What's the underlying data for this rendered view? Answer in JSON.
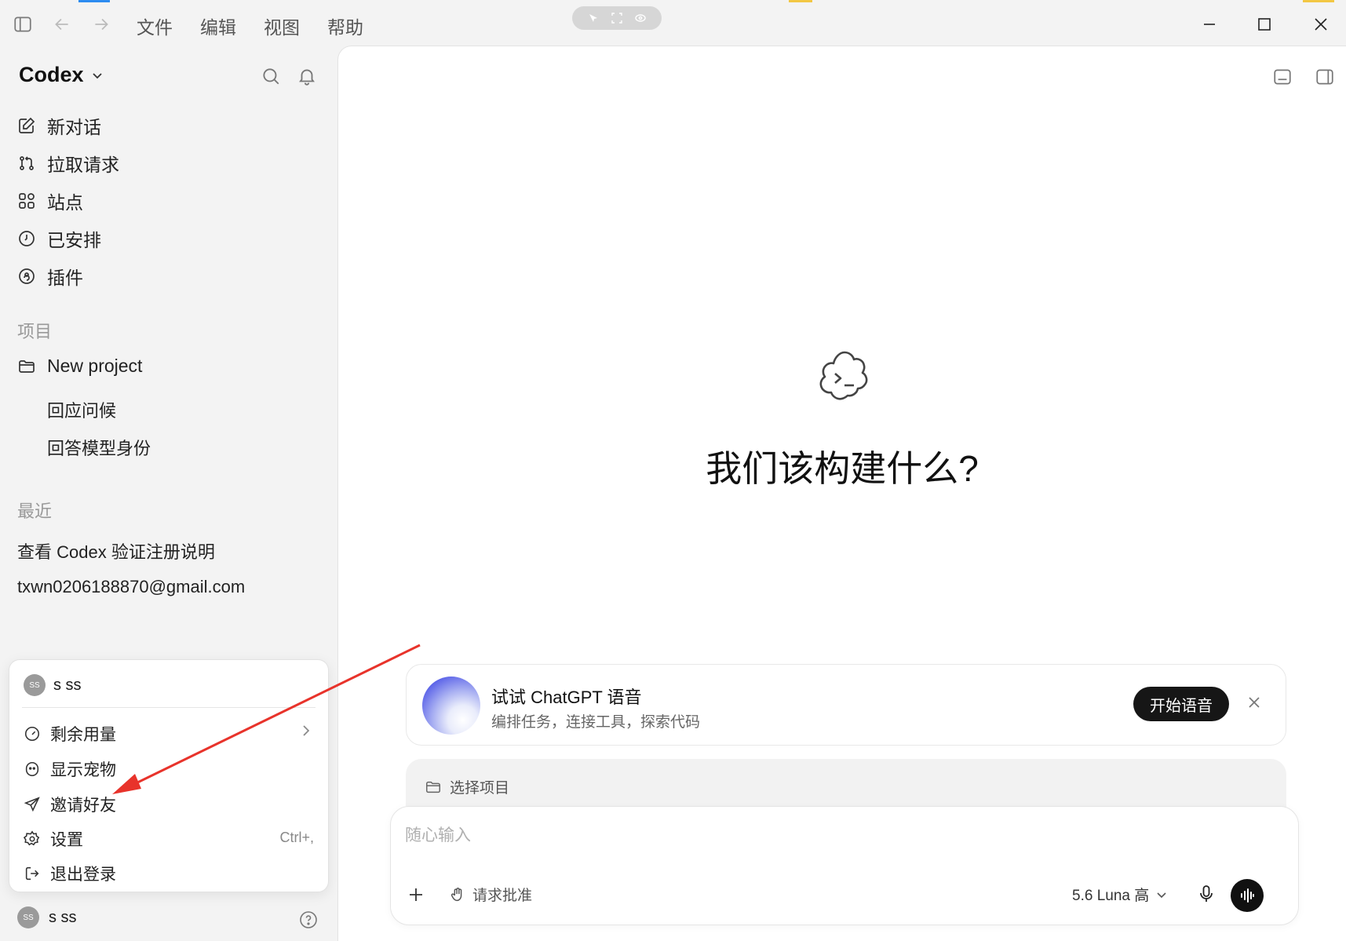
{
  "menubar": {
    "file": "文件",
    "edit": "编辑",
    "view": "视图",
    "help": "帮助"
  },
  "colors": {
    "annotation_arrow": "#e8332b",
    "accent_blue": "#2d8cf0",
    "accent_yellow": "#f2c744"
  },
  "sidebar": {
    "brand": "Codex",
    "nav": [
      {
        "label": "新对话",
        "icon": "edit-icon"
      },
      {
        "label": "拉取请求",
        "icon": "pull-request-icon"
      },
      {
        "label": "站点",
        "icon": "grid-icon"
      },
      {
        "label": "已安排",
        "icon": "clock-icon"
      },
      {
        "label": "插件",
        "icon": "plugin-icon"
      }
    ],
    "projects_label": "项目",
    "project_name": "New project",
    "project_threads": [
      "回应问候",
      "回答模型身份"
    ],
    "recent_label": "最近",
    "recent": [
      "查看 Codex 验证注册说明",
      "txwn0206188870@gmail.com"
    ]
  },
  "popup": {
    "avatar_text": "SS",
    "user_name": "s ss",
    "items": [
      {
        "label": "剩余用量",
        "icon": "gauge-icon"
      },
      {
        "label": "显示宠物",
        "icon": "pet-icon"
      },
      {
        "label": "邀请好友",
        "icon": "send-icon"
      },
      {
        "label": "设置",
        "icon": "gear-icon",
        "shortcut": "Ctrl+,"
      },
      {
        "label": "退出登录",
        "icon": "logout-icon"
      }
    ]
  },
  "bottom_user": {
    "avatar_text": "SS",
    "name": "s ss"
  },
  "main": {
    "hero_title": "我们该构建什么?",
    "voice_card": {
      "title": "试试 ChatGPT 语音",
      "subtitle": "编排任务，连接工具，探索代码",
      "button": "开始语音"
    },
    "project_selector": "选择项目",
    "composer": {
      "placeholder": "随心输入",
      "approval": "请求批准",
      "model": "5.6 Luna 高"
    }
  }
}
